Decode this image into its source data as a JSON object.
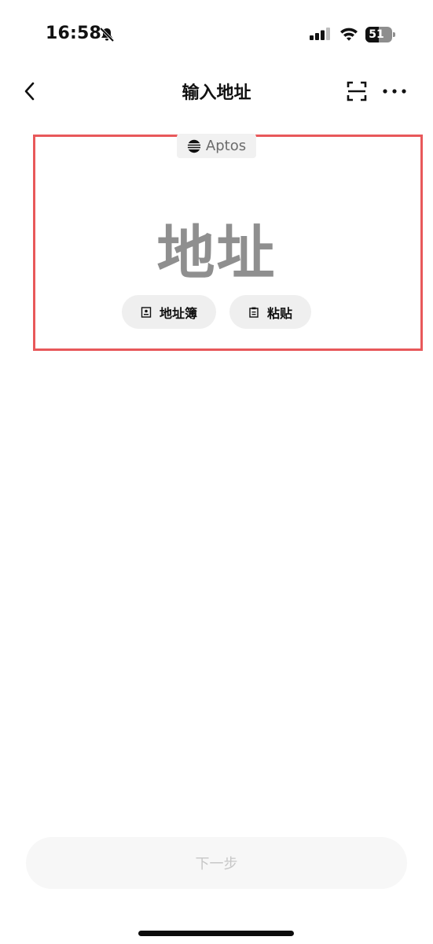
{
  "status_bar": {
    "time": "16:58",
    "battery_level": "51",
    "icons": [
      "bell-slash-icon",
      "cellular-signal-icon",
      "wifi-icon",
      "battery-icon"
    ]
  },
  "nav": {
    "title": "输入地址",
    "icons": [
      "chevron-left-icon",
      "scan-icon",
      "more-icon"
    ]
  },
  "chain": {
    "name": "Aptos",
    "icon": "aptos-logo-icon"
  },
  "address_input": {
    "placeholder": "地址"
  },
  "actions": {
    "address_book_label": "地址簿",
    "address_book_icon": "contact-book-icon",
    "paste_label": "粘贴",
    "paste_icon": "clipboard-icon"
  },
  "footer": {
    "next_label": "下一步"
  },
  "colors": {
    "highlight_border": "#e8585a",
    "placeholder_text": "#8f8f8f",
    "pill_background": "#efefef",
    "disabled_button_background": "#f7f7f7",
    "disabled_button_text": "#c7c7c7"
  }
}
